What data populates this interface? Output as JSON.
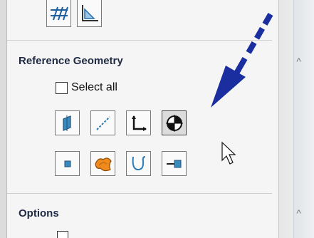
{
  "reference_section": {
    "title": "Reference Geometry",
    "collapse_glyph": "^"
  },
  "select_all": {
    "label": "Select all",
    "checked": false
  },
  "reference_tools_row1": [
    "plane-icon",
    "axis-icon",
    "coordinate-system-icon",
    "center-of-mass-icon"
  ],
  "reference_tools_row2": [
    "point-icon",
    "surface-icon",
    "curve-icon",
    "mate-reference-icon"
  ],
  "options_section": {
    "title": "Options",
    "collapse_glyph": "^"
  },
  "colors": {
    "accent_blue": "#1a2ea0",
    "icon_blue": "#2f7fb0",
    "icon_orange": "#f08a1c"
  }
}
